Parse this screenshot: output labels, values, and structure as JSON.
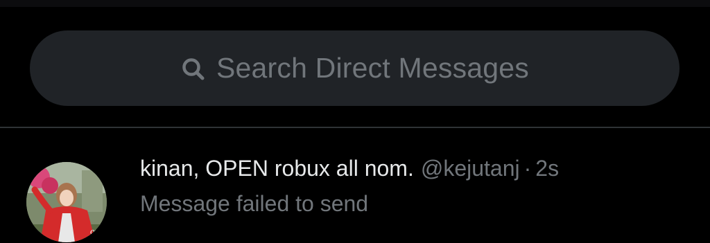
{
  "search": {
    "placeholder": "Search Direct Messages",
    "icon": "search-icon"
  },
  "conversations": [
    {
      "display_name": "kinan, OPEN robux all nom.",
      "handle": "@kejutanj",
      "separator": "·",
      "timestamp": "2s",
      "preview": "Message failed to send",
      "avatar_icon": "avatar-photo"
    }
  ],
  "colors": {
    "background": "#000000",
    "search_bg": "#202327",
    "primary_text": "#e7e9ea",
    "secondary_text": "#71767b",
    "divider": "#2f3336"
  }
}
